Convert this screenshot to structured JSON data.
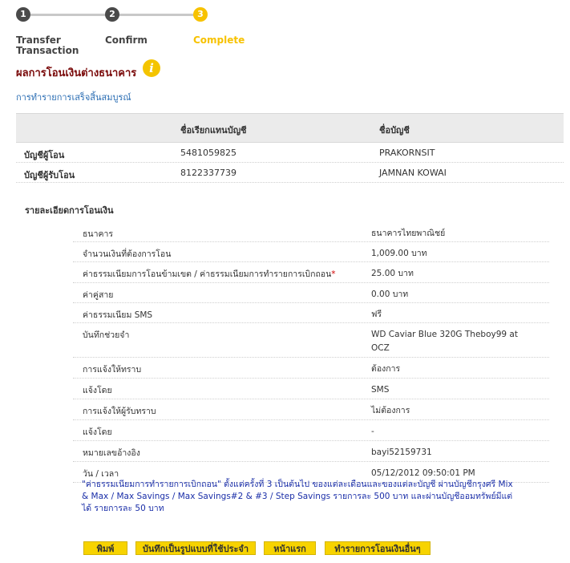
{
  "steps": [
    {
      "number": "1",
      "label": "Transfer Transaction",
      "state": "done"
    },
    {
      "number": "2",
      "label": "Confirm",
      "state": "done"
    },
    {
      "number": "3",
      "label": "Complete",
      "state": "active"
    }
  ],
  "page_title": "ผลการโอนเงินต่างธนาคาร",
  "info_icon": "i",
  "success_message": "การทำรายการเสร็จสิ้นสมบูรณ์",
  "accounts": {
    "headers": [
      "ชื่อเรียกแทนบัญชี",
      "ชื่อบัญชี"
    ],
    "rows": [
      {
        "label": "บัญชีผู้โอน",
        "number": "5481059825",
        "name": "PRAKORNSIT"
      },
      {
        "label": "บัญชีผู้รับโอน",
        "number": "8122337739",
        "name": "JAMNAN KOWAI"
      }
    ]
  },
  "details_title": "รายละเอียดการโอนเงิน",
  "details": [
    {
      "key": "ธนาคาร",
      "value": "ธนาคารไทยพาณิชย์"
    },
    {
      "key": "จำนวนเงินที่ต้องการโอน",
      "value": "1,009.00 บาท"
    },
    {
      "key": "ค่าธรรมเนียมการโอนข้ามเขต / ค่าธรรมเนียมการทำรายการเบิกถอน",
      "required_mark": "*",
      "value": "25.00 บาท"
    },
    {
      "key": "ค่าคู่สาย",
      "value": "0.00 บาท"
    },
    {
      "key": "ค่าธรรมเนียม SMS",
      "value": "ฟรี"
    },
    {
      "key": "บันทึกช่วยจำ",
      "value": "WD Caviar Blue 320G Theboy99 at OCZ"
    },
    {
      "key": "การแจ้งให้ทราบ",
      "value": "ต้องการ"
    },
    {
      "key": "แจ้งโดย",
      "value": "SMS"
    },
    {
      "key": "การแจ้งให้ผู้รับทราบ",
      "value": "ไม่ต้องการ"
    },
    {
      "key": "แจ้งโดย",
      "value": "-"
    },
    {
      "key": "หมายเลขอ้างอิง",
      "value": "bayi52159731"
    },
    {
      "key": "วัน / เวลา",
      "value": "05/12/2012 09:50:01 PM"
    }
  ],
  "note": "\"ค่าธรรมเนียมการทำรายการเบิกถอน\" ตั้งแต่ครั้งที่ 3 เป็นต้นไป ของแต่ละเดือนและของแต่ละบัญชี ผ่านบัญชีกรุงศรี Mix & Max / Max Savings / Max Savings#2 & #3 / Step Savings รายการละ 500 บาท และผ่านบัญชีออมทรัพย์มีแต่ได้ รายการละ 50 บาท",
  "buttons": {
    "print": "พิมพ์",
    "save_template": "บันทึกเป็นรูปแบบที่ใช้ประจำ",
    "home": "หน้าแรก",
    "new_transfer": "ทำรายการโอนเงินอื่นๆ"
  },
  "colors": {
    "accent": "#f7c200",
    "title": "#7a0a0a",
    "link": "#2a6db3",
    "note": "#1a2ea8"
  }
}
